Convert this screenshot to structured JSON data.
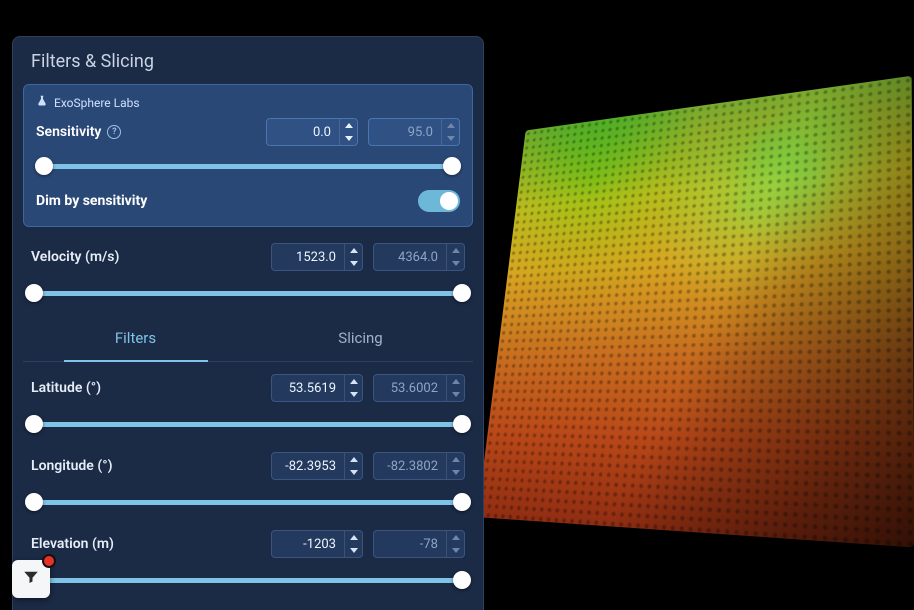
{
  "panel": {
    "title": "Filters & Slicing",
    "brand": "ExoSphere Labs",
    "sensitivity": {
      "label": "Sensitivity",
      "min": "0.0",
      "max": "95.0"
    },
    "dim": {
      "label": "Dim by sensitivity",
      "on": true
    },
    "velocity": {
      "label": "Velocity (m/s)",
      "min": "1523.0",
      "max": "4364.0"
    },
    "tabs": {
      "filters": "Filters",
      "slicing": "Slicing",
      "active": "filters"
    },
    "latitude": {
      "label": "Latitude (°)",
      "min": "53.5619",
      "max": "53.6002"
    },
    "longitude": {
      "label": "Longitude (°)",
      "min": "-82.3953",
      "max": "-82.3802"
    },
    "elevation": {
      "label": "Elevation (m)",
      "min": "-1203",
      "max": "-78"
    }
  }
}
